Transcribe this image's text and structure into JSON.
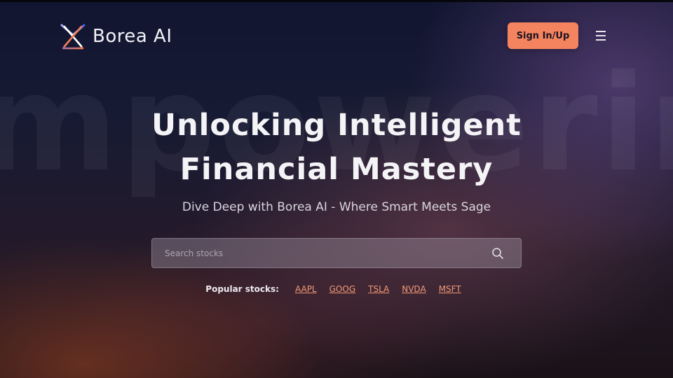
{
  "header": {
    "brand_name": "Borea AI",
    "logo_icon": "borea-x-logo-icon",
    "signin_label": "Sign In/Up",
    "menu_icon": "hamburger-menu-icon"
  },
  "background": {
    "watermark_text": "mpowerin"
  },
  "hero": {
    "title_line1": "Unlocking Intelligent",
    "title_line2": "Financial Mastery",
    "subtitle": "Dive Deep with Borea AI - Where Smart Meets Sage"
  },
  "search": {
    "placeholder": "Search stocks",
    "value": "",
    "icon": "search-icon"
  },
  "popular": {
    "label": "Popular stocks:",
    "tickers": [
      "AAPL",
      "GOOG",
      "TSLA",
      "NVDA",
      "MSFT"
    ]
  },
  "colors": {
    "accent": "#f4845f",
    "ticker_link": "#f29a77",
    "background": "#111530"
  }
}
